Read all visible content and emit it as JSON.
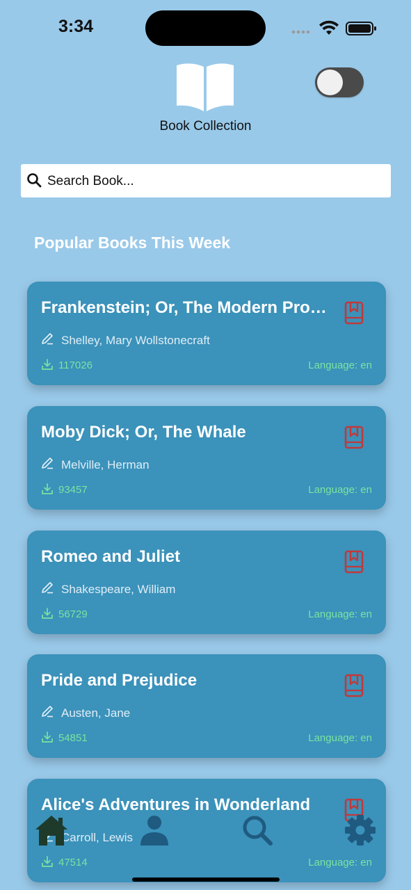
{
  "status_bar": {
    "time": "3:34"
  },
  "header": {
    "app_title": "Book Collection"
  },
  "search": {
    "placeholder": "Search Book..."
  },
  "section": {
    "title": "Popular Books This Week"
  },
  "books": [
    {
      "title": "Frankenstein; Or, The Modern Prometheus",
      "author": "Shelley, Mary Wollstonecraft",
      "downloads": "117026",
      "language": "Language: en"
    },
    {
      "title": "Moby Dick; Or, The Whale",
      "author": "Melville, Herman",
      "downloads": "93457",
      "language": "Language: en"
    },
    {
      "title": "Romeo and Juliet",
      "author": "Shakespeare, William",
      "downloads": "56729",
      "language": "Language: en"
    },
    {
      "title": "Pride and Prejudice",
      "author": "Austen, Jane",
      "downloads": "54851",
      "language": "Language: en"
    },
    {
      "title": "Alice's Adventures in Wonderland",
      "author": "Carroll, Lewis",
      "downloads": "47514",
      "language": "Language: en"
    }
  ],
  "bottom_nav": {
    "items": [
      {
        "icon": "home-icon",
        "active": true
      },
      {
        "icon": "person-icon",
        "active": false
      },
      {
        "icon": "search-icon",
        "active": false
      },
      {
        "icon": "gear-icon",
        "active": false
      }
    ]
  },
  "colors": {
    "background": "#99c9e9",
    "card": "#3b92ba",
    "bookmark": "#c0393b",
    "meta_green": "#7be3a1",
    "nav_active": "#1e3a2a",
    "nav_inactive": "#1f5a80"
  }
}
